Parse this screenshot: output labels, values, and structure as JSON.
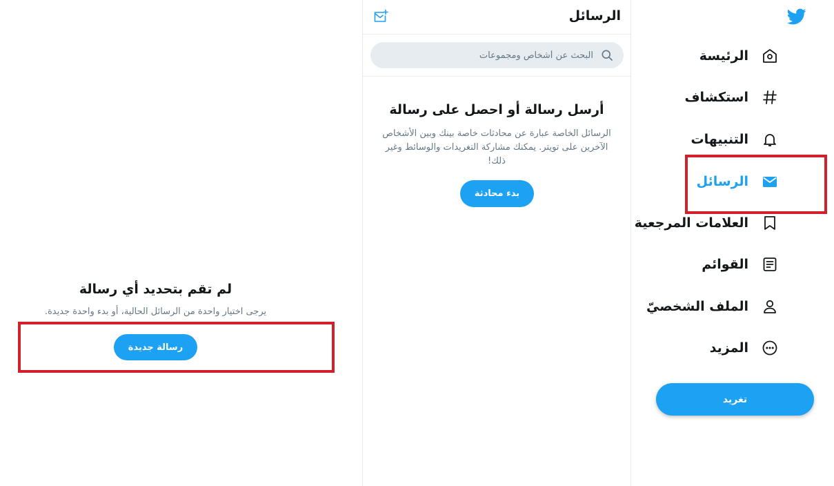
{
  "sidebar": {
    "logo_icon": "twitter-bird-icon",
    "items": [
      {
        "label": "الرئيسة",
        "icon": "home-icon"
      },
      {
        "label": "استكشاف",
        "icon": "hashtag-icon"
      },
      {
        "label": "التنبيهات",
        "icon": "bell-icon"
      },
      {
        "label": "الرسائل",
        "icon": "envelope-icon",
        "active": true
      },
      {
        "label": "العلامات المرجعية",
        "icon": "bookmark-icon"
      },
      {
        "label": "القوائم",
        "icon": "list-icon"
      },
      {
        "label": "الملف الشخصيّ",
        "icon": "person-icon"
      },
      {
        "label": "المزيد",
        "icon": "more-icon"
      }
    ],
    "tweet_label": "تغريد"
  },
  "messages": {
    "title": "الرسائل",
    "compose_icon": "compose-message-icon",
    "search_placeholder": "البحث عن أشخاص ومجموعات",
    "empty_title": "أرسل رسالة أو احصل على رسالة",
    "empty_desc": "الرسائل الخاصة عبارة عن محادثات خاصة بينك وبين الأشخاص الآخرين على تويتر. يمكنك مشاركة التغريدات والوسائط وغير ذلك!",
    "start_label": "بدء محادثة"
  },
  "detail": {
    "title": "لم تقم بتحديد أي رسالة",
    "desc": "يرجى اختيار واحدة من الرسائل الحالية، أو بدء واحدة جديدة.",
    "new_message_label": "رسالة جديدة"
  },
  "colors": {
    "accent": "#1da1f2",
    "highlight": "#d0202a",
    "text": "#14171a",
    "muted": "#657786",
    "border": "#e6ecf0"
  }
}
